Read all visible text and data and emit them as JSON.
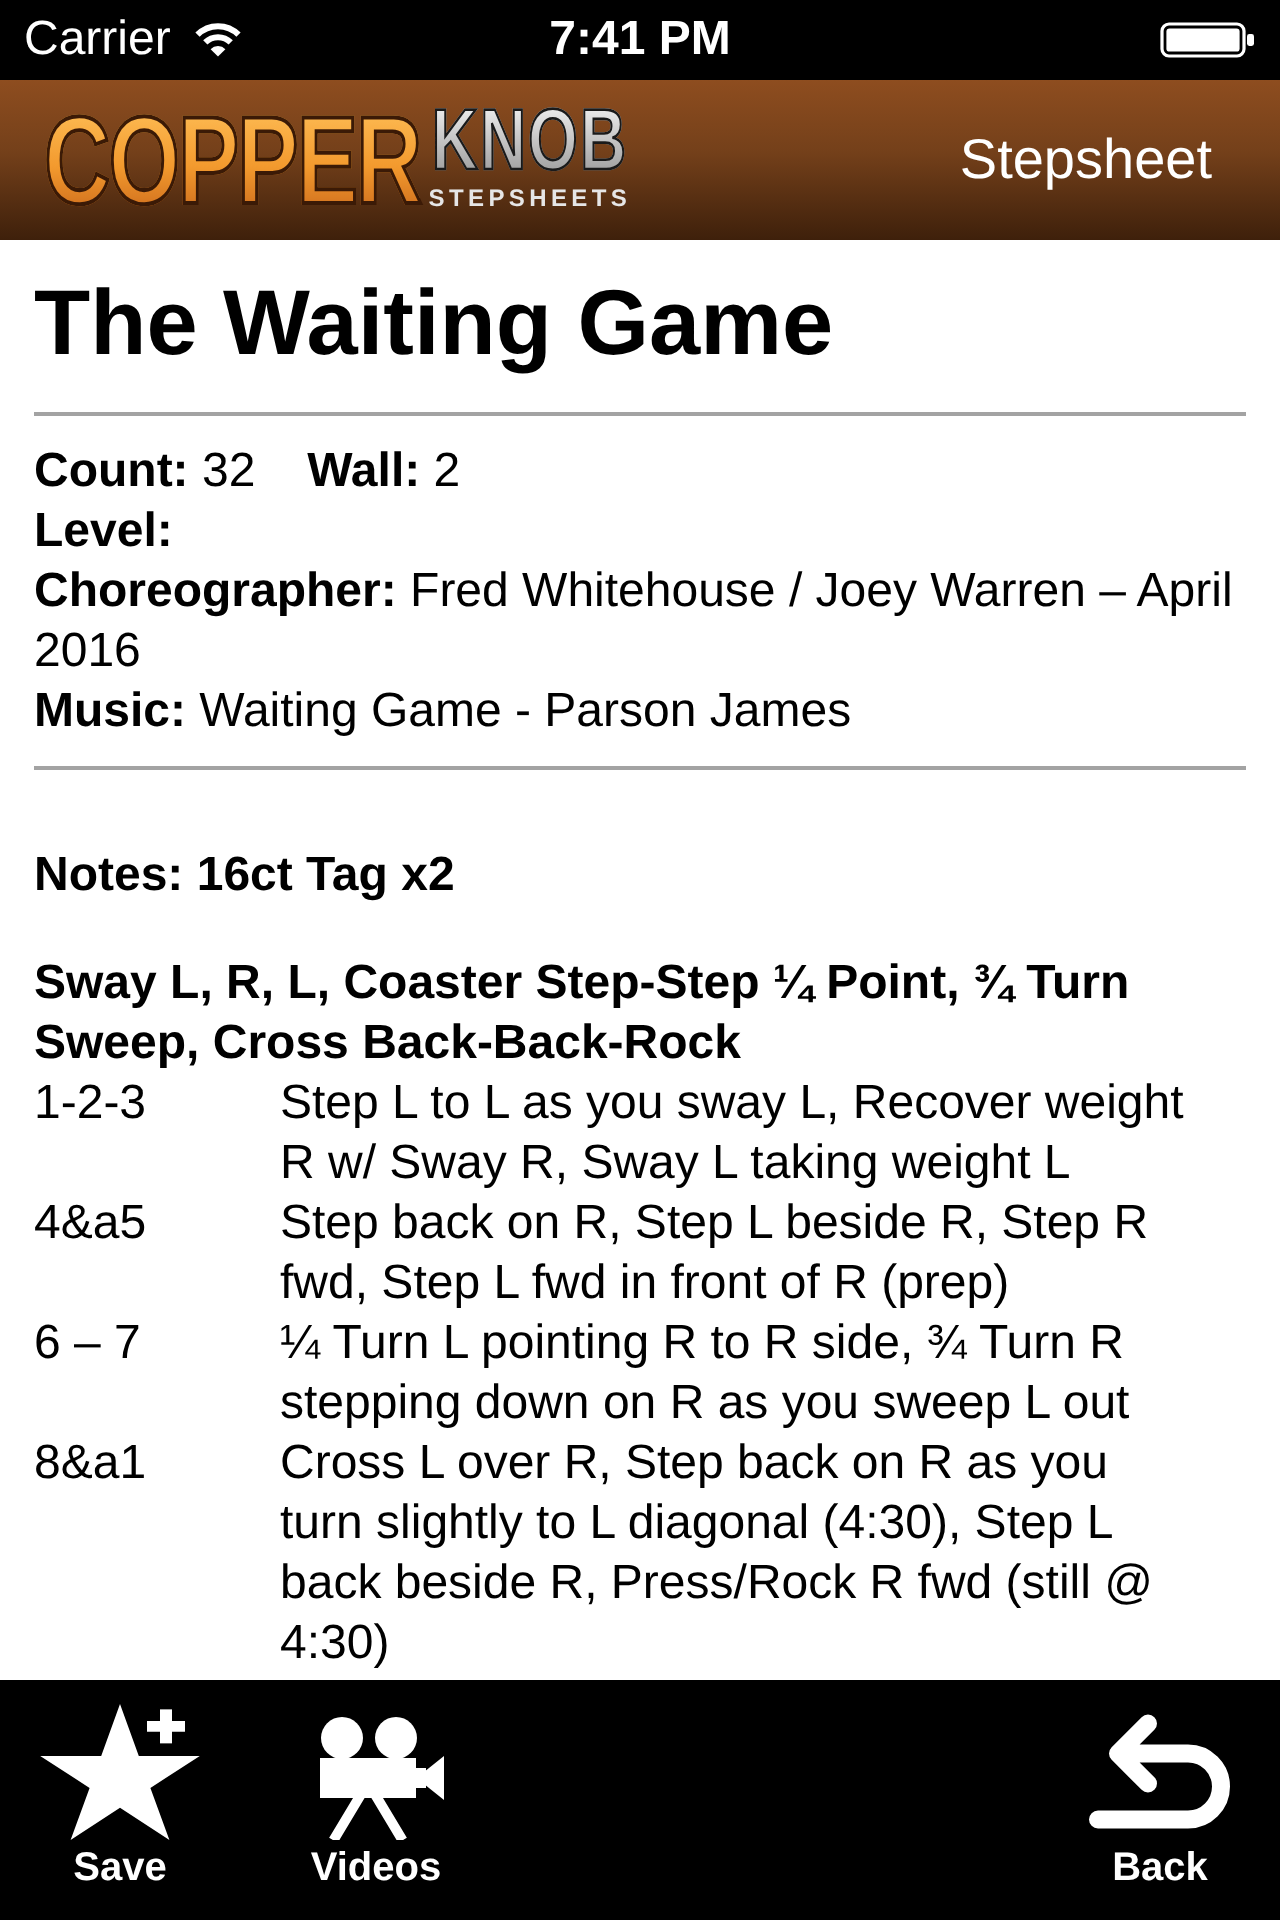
{
  "status_bar": {
    "carrier": "Carrier",
    "time": "7:41 PM"
  },
  "nav_bar": {
    "logo": {
      "main": "COPPER",
      "accent": "KNOB",
      "tagline": "STEPSHEETS"
    },
    "title": "Stepsheet"
  },
  "stepsheet": {
    "title": "The Waiting Game",
    "details": [
      [
        {
          "label": "Count:",
          "value": "32"
        },
        {
          "label": "Wall:",
          "value": "2"
        }
      ],
      [
        {
          "label": "Level:"
        }
      ],
      [
        {
          "label": "Choreographer:",
          "value": "Fred Whitehouse / Joey Warren – April 2016"
        }
      ],
      [
        {
          "label": "Music:",
          "value": "Waiting Game - Parson James"
        }
      ]
    ],
    "notes": "Notes: 16ct Tag x2",
    "sections": [
      {
        "heading": "Sway L, R, L, Coaster Step-Step ¼ Point, ¾ Turn Sweep, Cross Back-Back-Rock",
        "steps": [
          {
            "count": "1-2-3",
            "description": "Step L to L as you sway L, Recover weight R w/ Sway R, Sway L taking weight L"
          },
          {
            "count": "4&a5",
            "description": "Step back on R, Step L beside R, Step R fwd, Step L fwd in front of R (prep)"
          },
          {
            "count": "6 – 7",
            "description": "¼ Turn L pointing R to R side, ¾ Turn R stepping down on R as you sweep L out"
          },
          {
            "count": "8&a1",
            "description": "Cross L over R, Step back on R as you turn slightly to L diagonal (4:30), Step L back beside R, Press/Rock R fwd (still @ 4:30)"
          }
        ]
      }
    ]
  },
  "toolbar": {
    "save": {
      "label": "Save"
    },
    "videos": {
      "label": "Videos"
    },
    "back": {
      "label": "Back"
    }
  }
}
